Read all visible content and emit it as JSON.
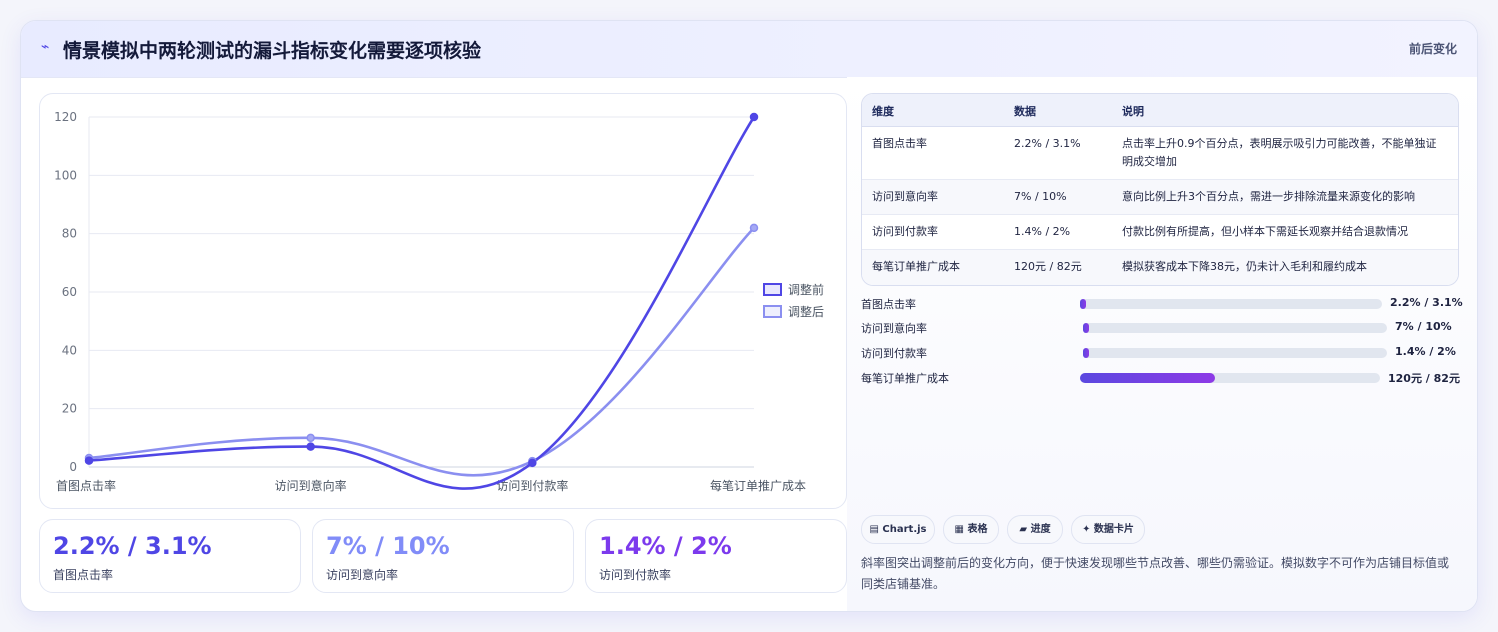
{
  "header": {
    "title": "情景模拟中两轮测试的漏斗指标变化需要逐项核验",
    "tag": "前后变化"
  },
  "chart_data": {
    "type": "line",
    "categories": [
      "首图点击率",
      "访问到意向率",
      "访问到付款率",
      "每笔订单推广成本"
    ],
    "series": [
      {
        "name": "调整前",
        "values": [
          2.2,
          7,
          1.4,
          120
        ],
        "color": "#4f46e5"
      },
      {
        "name": "调整后",
        "values": [
          3.1,
          10,
          2,
          82
        ],
        "color": "#8b8ff0"
      }
    ],
    "yticks": [
      0,
      20,
      40,
      60,
      80,
      100,
      120
    ],
    "ylim": [
      0,
      120
    ],
    "grid": true,
    "smooth": true,
    "legend": "right"
  },
  "kpis": [
    {
      "value": "2.2% / 3.1%",
      "label": "首图点击率",
      "color": "#4f46e5"
    },
    {
      "value": "7% / 10%",
      "label": "访问到意向率",
      "color": "#818cf8"
    },
    {
      "value": "1.4% / 2%",
      "label": "访问到付款率",
      "color": "#7c3aed"
    }
  ],
  "table": {
    "headers": [
      "维度",
      "数据",
      "说明"
    ],
    "rows": [
      {
        "dim": "首图点击率",
        "data": "2.2% / 3.1%",
        "desc": "点击率上升0.9个百分点，表明展示吸引力可能改善，不能单独证明成交增加"
      },
      {
        "dim": "访问到意向率",
        "data": "7% / 10%",
        "desc": "意向比例上升3个百分点，需进一步排除流量来源变化的影响"
      },
      {
        "dim": "访问到付款率",
        "data": "1.4% / 2%",
        "desc": "付款比例有所提高，但小样本下需延长观察并结合退款情况"
      },
      {
        "dim": "每笔订单推广成本",
        "data": "120元 / 82元",
        "desc": "模拟获客成本下降38元，仍未计入毛利和履约成本"
      }
    ]
  },
  "progress": [
    {
      "label": "首图点击率",
      "value": "2.2% / 3.1%",
      "fill": 0.02
    },
    {
      "label": "访问到意向率",
      "value": "7% / 10%",
      "fill": 0.02
    },
    {
      "label": "访问到付款率",
      "value": "1.4% / 2%",
      "fill": 0.02
    },
    {
      "label": "每笔订单推广成本",
      "value": "120元 / 82元",
      "fill": 0.45
    }
  ],
  "tags": [
    "▤ Chart.js",
    "▦ 表格",
    "▰ 进度",
    "✦ 数据卡片"
  ],
  "note": "斜率图突出调整前后的变化方向，便于快速发现哪些节点改善、哪些仍需验证。模拟数字不可作为店铺目标值或同类店铺基准。"
}
